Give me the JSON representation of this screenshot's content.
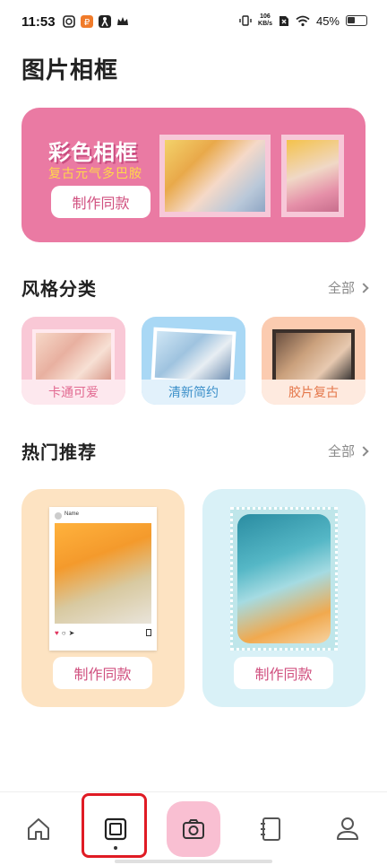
{
  "status_bar": {
    "time": "11:53",
    "net_speed_value": "106",
    "net_speed_unit": "KB/s",
    "battery_percent": "45%"
  },
  "page": {
    "title": "图片相框"
  },
  "banner": {
    "title": "彩色相框",
    "subtitle": "复古元气多巴胺",
    "button_label": "制作同款",
    "background_color": "#ea7aa3"
  },
  "style_section": {
    "title": "风格分类",
    "more_label": "全部",
    "categories": [
      {
        "label": "卡通可爱"
      },
      {
        "label": "清新简约"
      },
      {
        "label": "胶片复古"
      }
    ]
  },
  "hot_section": {
    "title": "热门推荐",
    "more_label": "全部",
    "cards": [
      {
        "button_label": "制作同款",
        "post_name": "Name"
      },
      {
        "button_label": "制作同款"
      }
    ]
  },
  "bottom_nav": {
    "items": [
      {
        "icon": "home-icon"
      },
      {
        "icon": "frame-icon",
        "selected": true
      },
      {
        "icon": "camera-icon"
      },
      {
        "icon": "notebook-icon"
      },
      {
        "icon": "profile-icon"
      }
    ]
  }
}
